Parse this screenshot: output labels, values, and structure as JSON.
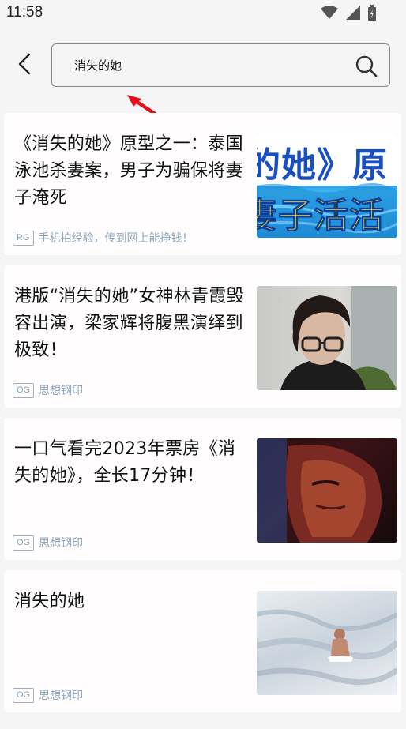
{
  "status_bar": {
    "time": "11:58"
  },
  "search": {
    "query": "消失的她"
  },
  "results": [
    {
      "title": "《消失的她》原型之一：泰国泳池杀妻案，男子为骗保将妻子淹死",
      "badge": "RG",
      "source": "手机拍经验，传到网上能挣钱！",
      "thumb_text_top": "的她》原",
      "thumb_text_bottom": "妻子活活"
    },
    {
      "title": "港版“消失的她”女神林青霞毁容出演，梁家辉将腹黑演绎到极致！",
      "badge": "OG",
      "source": "思想钢印"
    },
    {
      "title": "一口气看完2023年票房《消失的她》，全长17分钟！",
      "badge": "OG",
      "source": "思想钢印"
    },
    {
      "title": "消失的她",
      "badge": "OG",
      "source": "思想钢印"
    }
  ]
}
